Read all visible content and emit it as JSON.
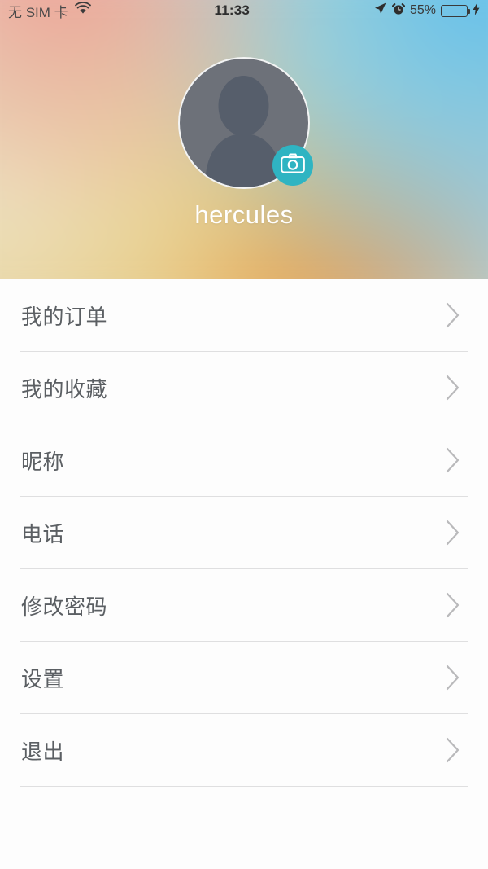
{
  "status_bar": {
    "carrier": "无 SIM 卡",
    "wifi_icon": "wifi-icon",
    "time": "11:33",
    "location_icon": "location-arrow-icon",
    "alarm_icon": "alarm-clock-icon",
    "battery_percent": "55%",
    "battery_level": 55,
    "battery_icon": "battery-icon",
    "charging_icon": "lightning-bolt-icon"
  },
  "profile": {
    "username": "hercules",
    "avatar_icon": "person-placeholder-icon",
    "camera_badge_icon": "camera-icon"
  },
  "menu": {
    "items": [
      {
        "label": "我的订单",
        "name": "my-orders",
        "chevron": "chevron-right-icon"
      },
      {
        "label": "我的收藏",
        "name": "my-favorites",
        "chevron": "chevron-right-icon"
      },
      {
        "label": "昵称",
        "name": "nickname",
        "chevron": "chevron-right-icon"
      },
      {
        "label": "电话",
        "name": "phone",
        "chevron": "chevron-right-icon"
      },
      {
        "label": "修改密码",
        "name": "change-password",
        "chevron": "chevron-right-icon"
      },
      {
        "label": "设置",
        "name": "settings",
        "chevron": "chevron-right-icon"
      },
      {
        "label": "退出",
        "name": "logout",
        "chevron": "chevron-right-icon"
      }
    ]
  },
  "colors": {
    "accent_teal": "#2fb4c2",
    "battery_green": "#4cd964",
    "row_text": "#5b5f63",
    "divider": "#dfdfe0",
    "page_background": "#fdfdfd"
  }
}
